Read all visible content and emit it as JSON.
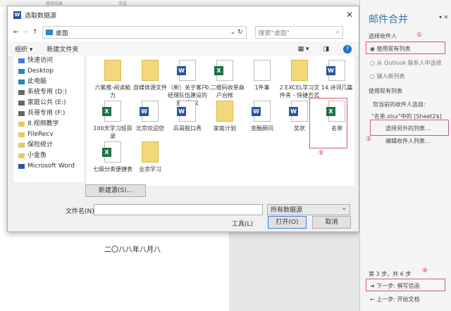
{
  "ribbon": {
    "tab1": "预览结果",
    "tab2": "完成"
  },
  "document": {
    "text": "二〇八八年八月八"
  },
  "dialog": {
    "title": "选取数据源",
    "address": "桌面",
    "search_placeholder": "搜索\"桌面\"",
    "organize": "组织 ▾",
    "new_folder": "新建文件夹",
    "nav": [
      "快速访问",
      "Desktop",
      "此电脑",
      "系统专用 (D:)",
      "家庭公共 (E:)",
      "兵哥专用 (F:)",
      "8.视频教学",
      "FileRecv",
      "保险统计",
      "小金鱼",
      "Microsoft Word"
    ],
    "files": [
      {
        "name": "六紫推-阅读能力",
        "type": "folder"
      },
      {
        "name": "自媒体源文件",
        "type": "folder"
      },
      {
        "name": "（新）关于客户经理队伍建设的若干建议",
        "type": "word"
      },
      {
        "name": "0.二维码收单商户台帐",
        "type": "excel"
      },
      {
        "name": "1件事",
        "type": "text"
      },
      {
        "name": "2.EXCEL学习文件夹 - 快捷方式",
        "type": "folder"
      },
      {
        "name": "14.诗词几篇",
        "type": "word"
      },
      {
        "name": "100天学习班目录",
        "type": "excel"
      },
      {
        "name": "北京欢迎您",
        "type": "word"
      },
      {
        "name": "兵哥脱口秀",
        "type": "word"
      },
      {
        "name": "家庭计划",
        "type": "folder"
      },
      {
        "name": "金融顾问",
        "type": "word"
      },
      {
        "name": "奖状",
        "type": "word"
      },
      {
        "name": "名单",
        "type": "excel"
      },
      {
        "name": "七级分类便捷表",
        "type": "excel"
      },
      {
        "name": "业余学习",
        "type": "pdf"
      }
    ],
    "new_source": "新建源(S)...",
    "filename_label": "文件名(N):",
    "filename_value": "",
    "filter": "所有数据源",
    "tools": "工具(L)",
    "open": "打开(O)",
    "cancel": "取消"
  },
  "pane": {
    "title": "邮件合并",
    "select_recipients": "选择收件人",
    "opt1": "使用现有列表",
    "opt2": "从 Outlook 联系人中选择",
    "opt3": "键入新列表",
    "use_existing": "使用现有列表",
    "current": "您当前的收件人选自:",
    "source": "\"名单.xlsx\"中的 [Sheet2$]",
    "choose_other": "选择另外的列表...",
    "edit_list": "编辑收件人列表...",
    "step": "第 3 步，共 6 步",
    "next": "下一步: 撰写信函",
    "prev": "上一步: 开始文档"
  },
  "annotations": {
    "c1": "①",
    "c2": "②",
    "c3": "③",
    "c4": "④"
  }
}
